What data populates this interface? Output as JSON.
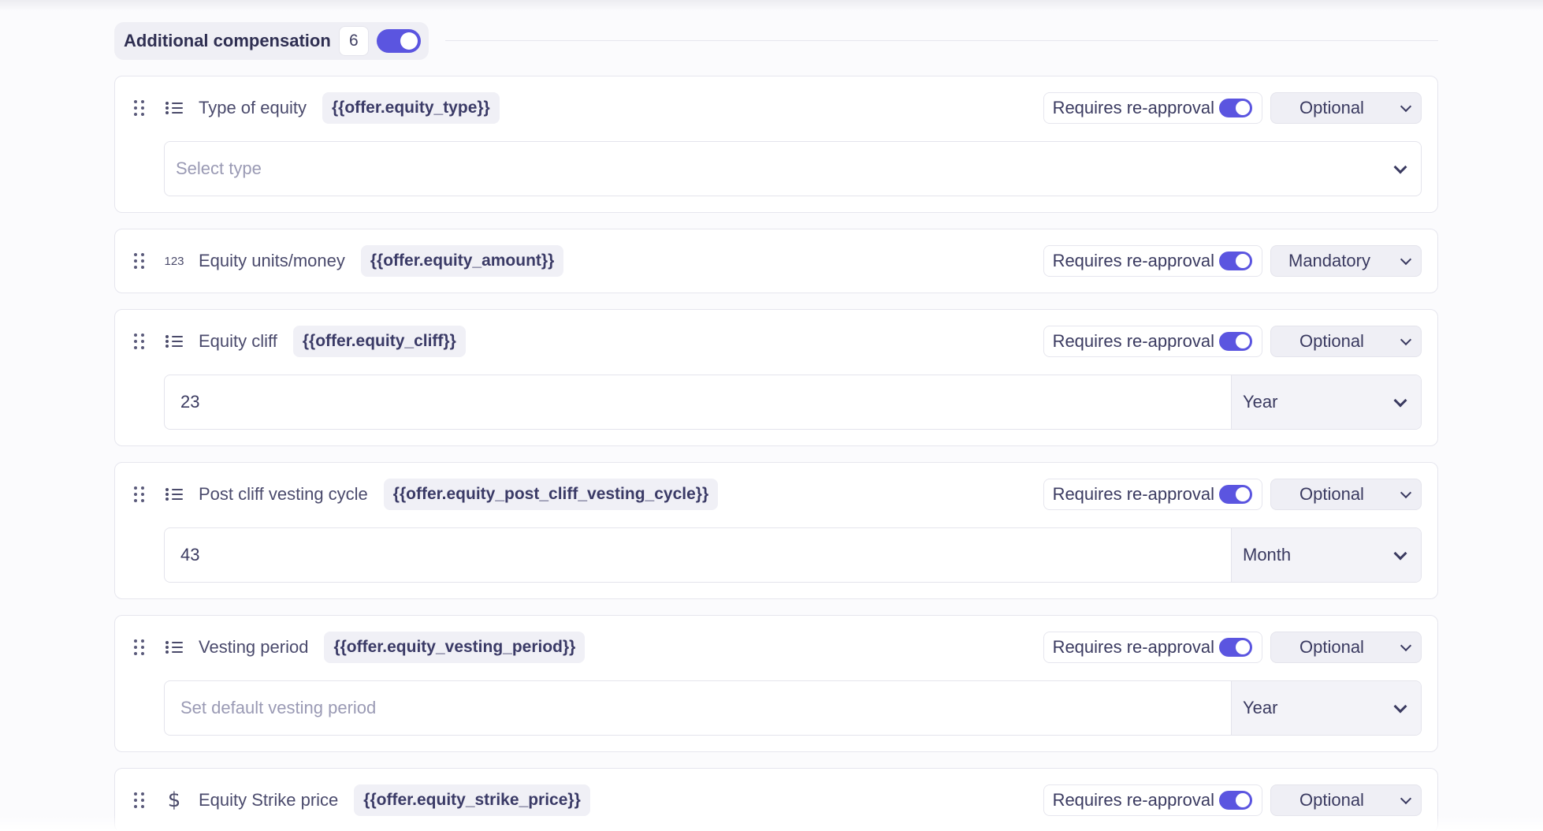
{
  "section": {
    "title": "Additional compensation",
    "count": "6"
  },
  "reapproval_label": "Requires re-approval",
  "colors": {
    "accent": "#5b55e0"
  },
  "fields": [
    {
      "icon": "list-icon",
      "label": "Type of equity",
      "variable": "{{offer.equity_type}}",
      "requirement": "Optional",
      "body": {
        "kind": "select",
        "placeholder": "Select type"
      }
    },
    {
      "icon": "number-icon",
      "icon_text": "123",
      "label": "Equity units/money",
      "variable": "{{offer.equity_amount}}",
      "requirement": "Mandatory"
    },
    {
      "icon": "list-icon",
      "label": "Equity cliff",
      "variable": "{{offer.equity_cliff}}",
      "requirement": "Optional",
      "body": {
        "kind": "combo",
        "value": "23",
        "unit": "Year"
      }
    },
    {
      "icon": "list-icon",
      "label": "Post cliff vesting cycle",
      "variable": "{{offer.equity_post_cliff_vesting_cycle}}",
      "requirement": "Optional",
      "body": {
        "kind": "combo",
        "value": "43",
        "unit": "Month"
      }
    },
    {
      "icon": "list-icon",
      "label": "Vesting period",
      "variable": "{{offer.equity_vesting_period}}",
      "requirement": "Optional",
      "body": {
        "kind": "combo",
        "placeholder": "Set default vesting period",
        "unit": "Year"
      }
    },
    {
      "icon": "dollar-icon",
      "icon_text": "$",
      "label": "Equity Strike price",
      "variable": "{{offer.equity_strike_price}}",
      "requirement": "Optional"
    }
  ]
}
